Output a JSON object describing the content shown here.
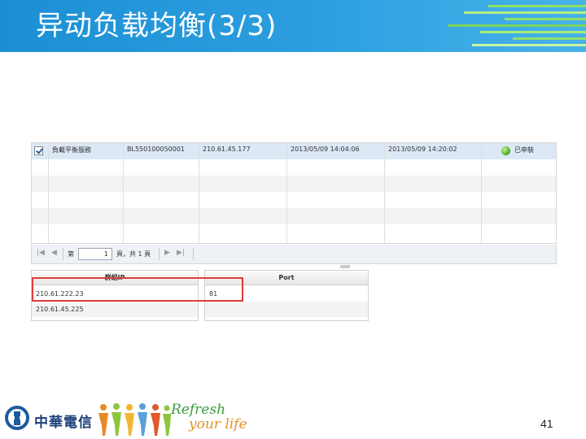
{
  "slide": {
    "title": "异动负载均衡(3/3)",
    "page_number": "41"
  },
  "grid": {
    "selected_row": {
      "checked": true,
      "service": "負載平衡服務",
      "id": "BL550100050001",
      "ip": "210.61.45.177",
      "start_time": "2013/05/09 14:04:06",
      "end_time": "2013/05/09 14:20:02",
      "status": "已申裝",
      "status_color": "#46a61d"
    },
    "pager": {
      "page_label_prefix": "第",
      "page_value": "1",
      "page_label_suffix": "頁，共 1 頁"
    }
  },
  "group_panel": {
    "header": "群組IP",
    "rows": [
      "210.61.222.23",
      "210.61.45.225"
    ]
  },
  "port_panel": {
    "header": "Port",
    "rows": [
      "81"
    ]
  },
  "footer": {
    "brand": "中華電信",
    "slogan_line1": "Refresh",
    "slogan_line2": "your life"
  },
  "colors": {
    "header_blue": "#1c8fd4",
    "highlight_red": "#e03c3c",
    "selected_row": "#dce8f6"
  }
}
